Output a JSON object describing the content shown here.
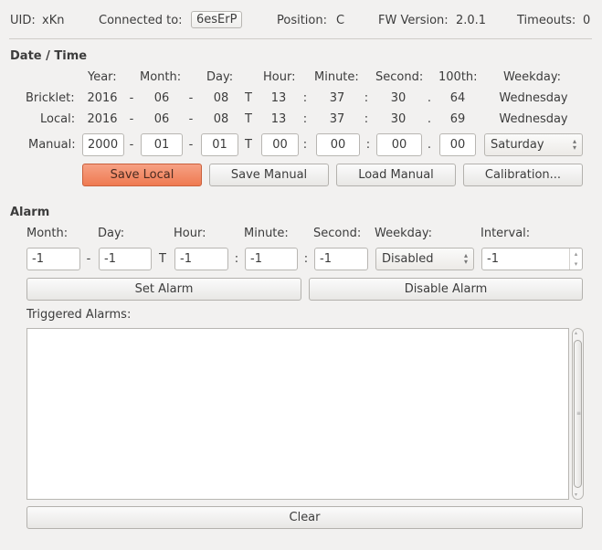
{
  "header": {
    "uid_label": "UID:",
    "uid_value": "xKn",
    "connected_label": "Connected to:",
    "connected_value": "6esErP",
    "position_label": "Position:",
    "position_value": "C",
    "fw_label": "FW Version:",
    "fw_value": "2.0.1",
    "timeouts_label": "Timeouts:",
    "timeouts_value": "0"
  },
  "datetime": {
    "title": "Date / Time",
    "columns": [
      "Year:",
      "Month:",
      "Day:",
      "Hour:",
      "Minute:",
      "Second:",
      "100th:",
      "Weekday:"
    ],
    "separators": [
      "-",
      "-",
      "T",
      ":",
      ":",
      "."
    ],
    "rows": [
      {
        "label": "Bricklet:",
        "values": [
          "2016",
          "06",
          "08",
          "13",
          "37",
          "30",
          "64"
        ],
        "weekday": "Wednesday"
      },
      {
        "label": "Local:",
        "values": [
          "2016",
          "06",
          "08",
          "13",
          "37",
          "30",
          "69"
        ],
        "weekday": "Wednesday"
      }
    ],
    "manual": {
      "label": "Manual:",
      "values": [
        "2000",
        "01",
        "01",
        "00",
        "00",
        "00",
        "00"
      ],
      "weekday": "Saturday"
    },
    "buttons": {
      "save_local": "Save Local",
      "save_manual": "Save Manual",
      "load_manual": "Load Manual",
      "calibration": "Calibration..."
    }
  },
  "alarm": {
    "title": "Alarm",
    "columns": [
      "Month:",
      "Day:",
      "Hour:",
      "Minute:",
      "Second:",
      "Weekday:",
      "Interval:"
    ],
    "separators": [
      "-",
      "T",
      ":",
      ":"
    ],
    "values": [
      "-1",
      "-1",
      "-1",
      "-1",
      "-1"
    ],
    "weekday": "Disabled",
    "interval": "-1",
    "set_button": "Set Alarm",
    "disable_button": "Disable Alarm",
    "triggered_label": "Triggered Alarms:",
    "triggered_text": "",
    "clear_button": "Clear"
  },
  "colors": {
    "accent": "#ef7a51",
    "background": "#f2f1f0"
  }
}
